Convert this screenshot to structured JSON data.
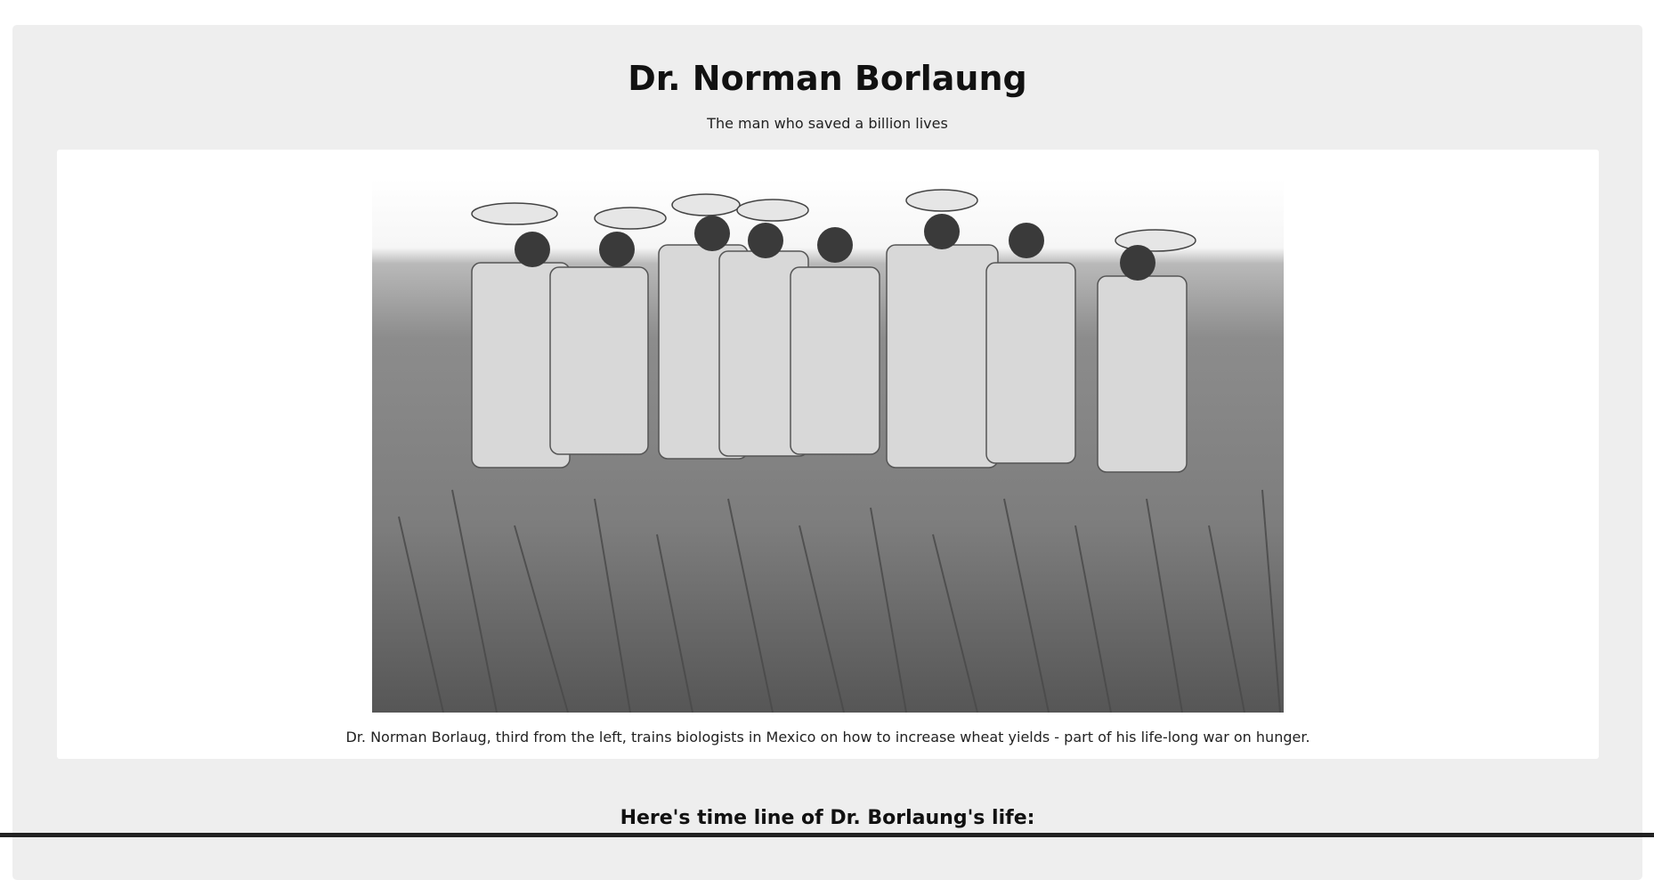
{
  "page": {
    "title": "Dr. Norman Borlaung",
    "subtitle": "The man who saved a billion lives",
    "image": {
      "caption": "Dr. Norman Borlaug, third from the left, trains biologists in Mexico on how to increase wheat yields - part of his life-long war on hunger."
    },
    "timeline": {
      "heading": "Here's time line of Dr. Borlaung's life:"
    }
  }
}
